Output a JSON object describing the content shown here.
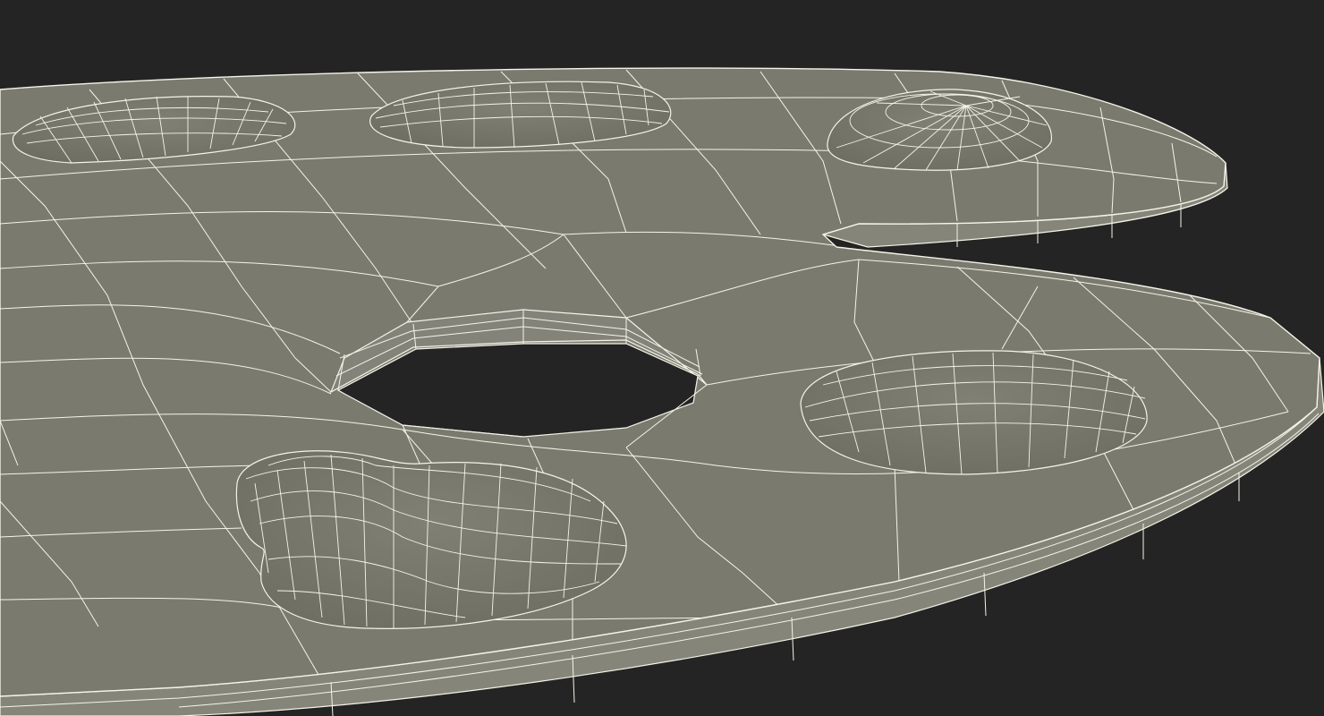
{
  "scene": {
    "subject": "artist-palette-wireframe",
    "background_color": "#242424",
    "surface_color": "#7a7a6e",
    "edge_color": "#7f7f73",
    "wire_color": "#f4f4e8",
    "paint_blob_color": "#77776b"
  }
}
